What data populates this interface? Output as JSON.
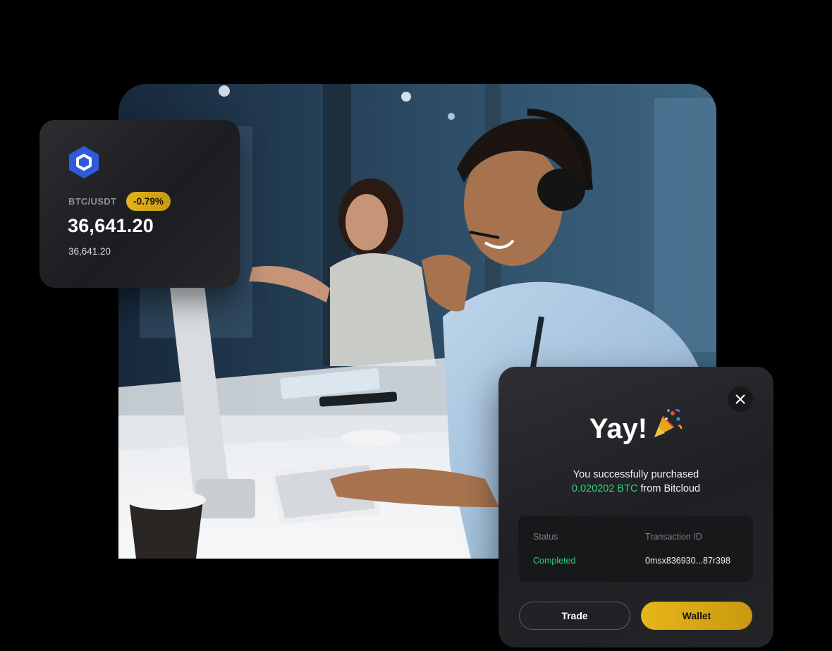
{
  "photo": {
    "icon": "office-photo"
  },
  "price_card": {
    "icon": "chainlink-hexagon-icon",
    "icon_color": "#2f5bdb",
    "pair": "BTC/USDT",
    "change": "-0.79%",
    "change_color": "#e3b319",
    "price": "36,641.20",
    "price_secondary": "36,641.20"
  },
  "modal": {
    "close_icon": "close-icon",
    "title": "Yay!",
    "title_emoji": "party-popper-icon",
    "message_prefix": "You successfully purchased",
    "amount": "0.020202 BTC",
    "message_suffix": " from Bitcloud",
    "amount_color": "#2fd17f",
    "details": {
      "status_label": "Status",
      "status_value": "Completed",
      "txid_label": "Transaction ID",
      "txid_value": "0msx836930...87r398"
    },
    "buttons": {
      "trade": "Trade",
      "wallet": "Wallet"
    }
  }
}
